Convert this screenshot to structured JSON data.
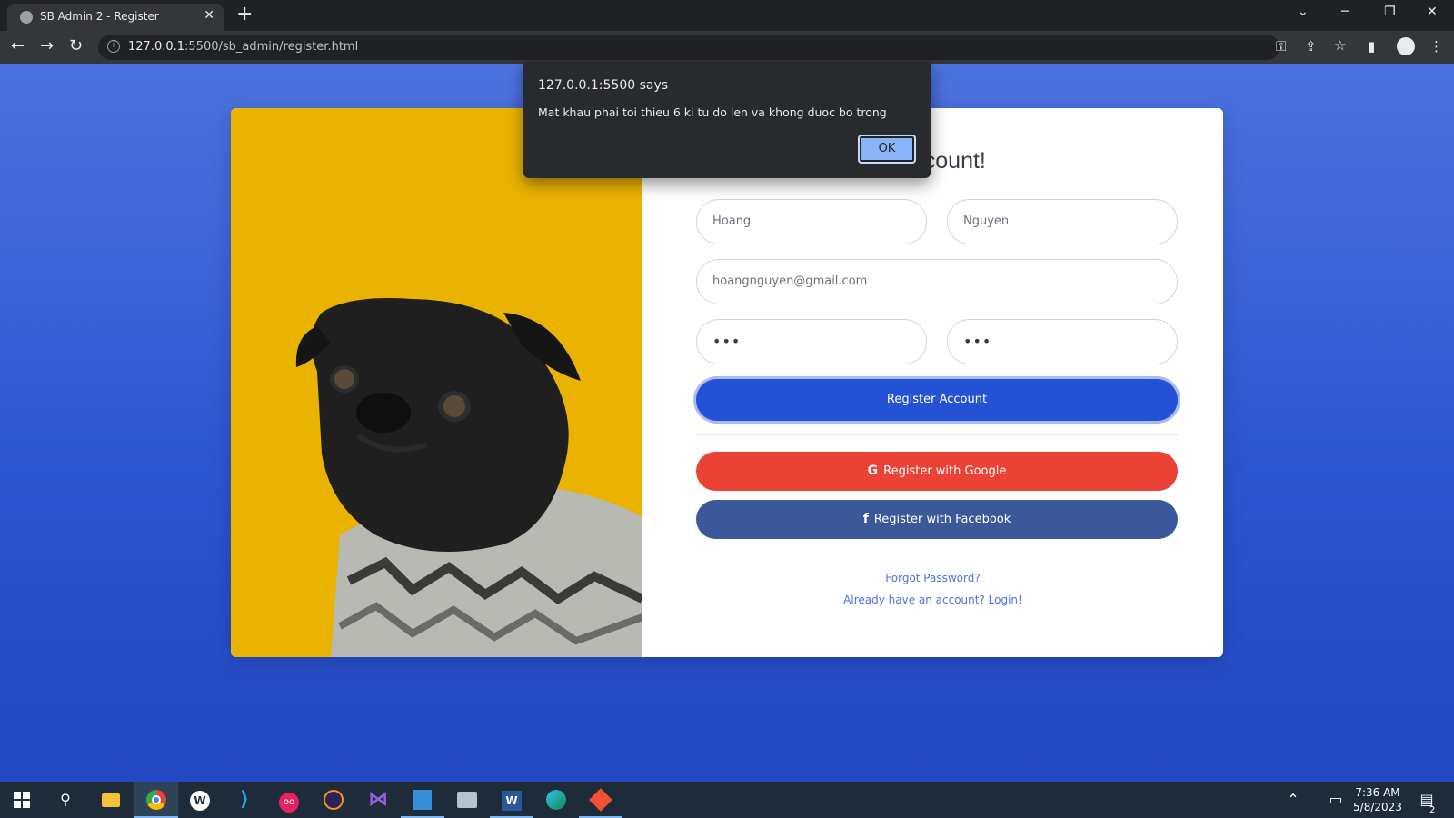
{
  "browser": {
    "tab_title": "SB Admin 2 - Register",
    "tab_close": "✕",
    "new_tab": "+",
    "url_host": "127.0.0.1",
    "url_rest": ":5500/sb_admin/register.html",
    "window_controls": [
      "⌄",
      "─",
      "❐",
      "✕"
    ],
    "toolbar_icons": [
      "key-icon",
      "share-icon",
      "star-icon",
      "sidebar-icon",
      "profile-icon",
      "menu-icon"
    ]
  },
  "dialog": {
    "title": "127.0.0.1:5500 says",
    "message": "Mat khau phai toi thieu 6 ki tu do len va khong duoc bo trong",
    "ok_label": "OK"
  },
  "form": {
    "heading_visible": "n Account!",
    "first_name": "Hoang",
    "last_name": "Nguyen",
    "email": "hoangnguyen@gmail.com",
    "password_mask": "•••",
    "repeat_password_mask": "•••",
    "register_button": "Register Account",
    "google_icon": "G",
    "google_button": "Register with Google",
    "facebook_icon": "f",
    "facebook_button": "Register with Facebook",
    "forgot_link": "Forgot Password?",
    "login_link": "Already have an account? Login!"
  },
  "taskbar": {
    "apps": [
      "start-icon",
      "search-icon",
      "file-explorer-icon",
      "chrome-icon",
      "app-w-icon",
      "vscode-icon",
      "app-oo-icon",
      "eclipse-icon",
      "visual-studio-icon",
      "app-blue-icon",
      "app-gray-icon",
      "word-icon",
      "edge-icon",
      "git-icon"
    ],
    "time": "7:36 AM",
    "date": "5/8/2023",
    "notification_count": "2"
  },
  "colors": {
    "page_bg": "#4e73df",
    "primary": "#2452d4",
    "google": "#ea4335",
    "facebook": "#3b5998",
    "photo_bg": "#ebb301"
  }
}
